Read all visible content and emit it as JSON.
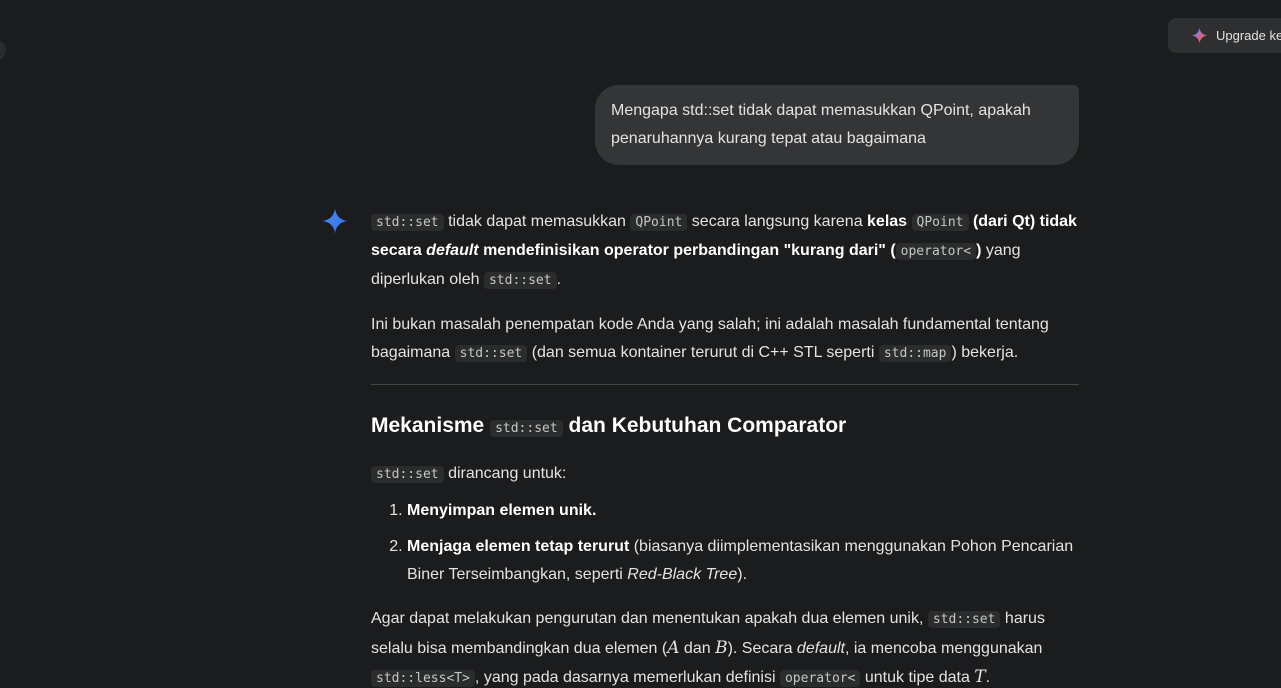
{
  "header": {
    "upgrade_label": "Upgrade ke",
    "upgrade_icon": "sparkle-multicolor-icon"
  },
  "user_message": {
    "text": "Mengapa std::set tidak dapat memasukkan QPoint, apakah\npenaruhannya kurang tepat atau bagaimana"
  },
  "response": {
    "icon": "gemini-sparkle-icon",
    "p1": {
      "c1": "std::set",
      "t1": " tidak dapat memasukkan ",
      "c2": "QPoint",
      "t2": " secara langsung karena ",
      "b1": "kelas",
      "c3": "QPoint",
      "b2": " (dari Qt) tidak secara ",
      "b2i": "default",
      "b3": " mendefinisikan operator perbandingan \"kurang dari\" (",
      "c4": "operator<",
      "b4": ")",
      "t3": " yang diperlukan oleh ",
      "c5": "std::set",
      "t4": "."
    },
    "p2": {
      "t1": "Ini bukan masalah penempatan kode Anda yang salah; ini adalah masalah fundamental tentang bagaimana ",
      "c1": "std::set",
      "t2": " (dan semua kontainer terurut di C++ STL seperti ",
      "c2": "std::map",
      "t3": ") bekerja."
    },
    "heading": {
      "t1": "Mekanisme ",
      "c1": "std::set",
      "t2": " dan Kebutuhan Comparator"
    },
    "p3": {
      "c1": "std::set",
      "t1": " dirancang untuk:"
    },
    "list": {
      "item1_bold": "Menyimpan elemen unik.",
      "item2_bold": "Menjaga elemen tetap terurut",
      "item2_t1": " (biasanya diimplementasikan menggunakan Pohon Pencarian Biner Terseimbangkan, seperti ",
      "item2_i": "Red-Black Tree",
      "item2_t2": ")."
    },
    "p4": {
      "t1": "Agar dapat melakukan pengurutan dan menentukan apakah dua elemen unik, ",
      "c1": "std::set",
      "t2": " harus selalu bisa membandingkan dua elemen (",
      "m1": "A",
      "t3": " dan ",
      "m2": "B",
      "t4": "). Secara ",
      "i1": "default",
      "t5": ", ia mencoba menggunakan ",
      "c2": "std::less<T>",
      "t6": ", yang pada dasarnya memerlukan definisi ",
      "c3": "operator<",
      "t7": " untuk tipe data ",
      "m3": "T",
      "t8": "."
    }
  }
}
